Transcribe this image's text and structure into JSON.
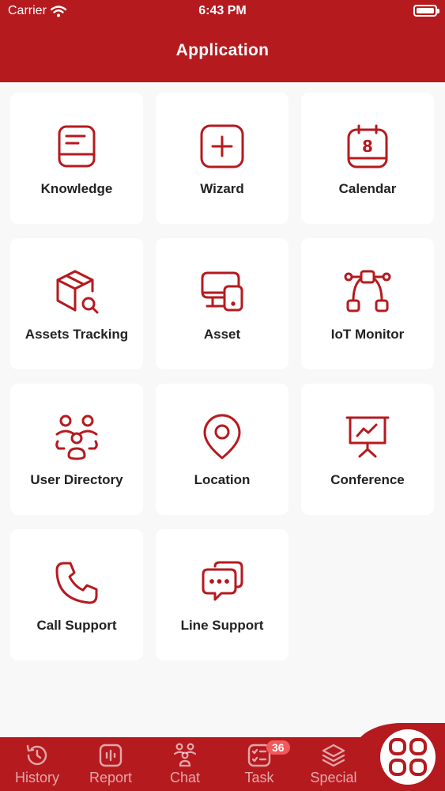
{
  "status_bar": {
    "carrier": "Carrier",
    "time": "6:43 PM"
  },
  "header": {
    "title": "Application"
  },
  "apps": [
    {
      "label": "Knowledge",
      "icon": "book-icon"
    },
    {
      "label": "Wizard",
      "icon": "plus-square-icon"
    },
    {
      "label": "Calendar",
      "icon": "calendar-icon",
      "calendar_day": "8"
    },
    {
      "label": "Assets Tracking",
      "icon": "box-search-icon"
    },
    {
      "label": "Asset",
      "icon": "devices-icon"
    },
    {
      "label": "IoT Monitor",
      "icon": "vector-nodes-icon"
    },
    {
      "label": "User Directory",
      "icon": "users-group-icon"
    },
    {
      "label": "Location",
      "icon": "location-pin-icon"
    },
    {
      "label": "Conference",
      "icon": "presentation-board-icon"
    },
    {
      "label": "Call Support",
      "icon": "phone-icon"
    },
    {
      "label": "Line Support",
      "icon": "chat-bubbles-icon"
    }
  ],
  "tabbar": {
    "tabs": [
      {
        "label": "History",
        "icon": "history-icon"
      },
      {
        "label": "Report",
        "icon": "report-icon"
      },
      {
        "label": "Chat",
        "icon": "group-chat-icon"
      },
      {
        "label": "Task",
        "icon": "task-list-icon",
        "badge": "36"
      },
      {
        "label": "Special",
        "icon": "layers-icon"
      }
    ],
    "apps_button_icon": "grid-apps-icon"
  },
  "colors": {
    "primary": "#b51a1f",
    "icon": "#b51a1f",
    "background": "#f8f8f8",
    "badge": "#f05a5a"
  }
}
